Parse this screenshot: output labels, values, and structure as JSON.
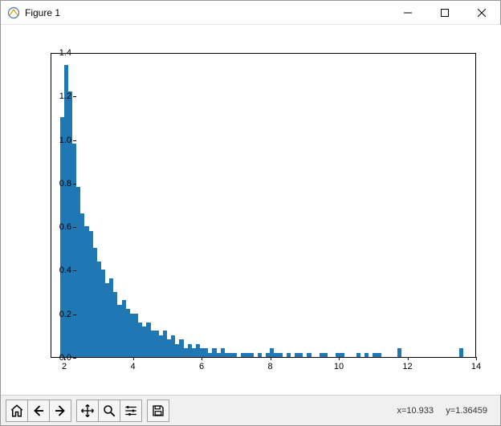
{
  "window": {
    "title": "Figure 1"
  },
  "toolbar": {
    "buttons": [
      {
        "name": "home-button",
        "icon": "home-icon"
      },
      {
        "name": "back-button",
        "icon": "arrow-left-icon"
      },
      {
        "name": "forward-button",
        "icon": "arrow-right-icon"
      },
      {
        "name": "pan-button",
        "icon": "move-icon"
      },
      {
        "name": "zoom-button",
        "icon": "magnify-icon"
      },
      {
        "name": "subplots-button",
        "icon": "sliders-icon"
      },
      {
        "name": "save-button",
        "icon": "save-icon"
      }
    ],
    "coord_readout": "x=10.933     y=1.36459"
  },
  "chart_data": {
    "type": "bar",
    "title": "",
    "xlabel": "",
    "ylabel": "",
    "xlim": [
      1.6,
      14.0
    ],
    "ylim": [
      0.0,
      1.4
    ],
    "xticks": [
      2,
      4,
      6,
      8,
      10,
      12,
      14
    ],
    "yticks": [
      0.0,
      0.2,
      0.4,
      0.6,
      0.8,
      1.0,
      1.2,
      1.4
    ],
    "bar_color": "#1f77b4",
    "bin_width": 0.12,
    "bins_start": 1.85,
    "values": [
      1.1,
      1.34,
      1.22,
      0.98,
      0.78,
      0.66,
      0.6,
      0.58,
      0.5,
      0.44,
      0.4,
      0.34,
      0.36,
      0.3,
      0.24,
      0.26,
      0.22,
      0.2,
      0.2,
      0.16,
      0.14,
      0.16,
      0.12,
      0.12,
      0.1,
      0.12,
      0.08,
      0.1,
      0.06,
      0.08,
      0.04,
      0.06,
      0.04,
      0.06,
      0.04,
      0.04,
      0.02,
      0.04,
      0.02,
      0.04,
      0.02,
      0.02,
      0.02,
      0.0,
      0.02,
      0.02,
      0.02,
      0.0,
      0.02,
      0.0,
      0.02,
      0.04,
      0.02,
      0.02,
      0.0,
      0.02,
      0.0,
      0.02,
      0.02,
      0.0,
      0.02,
      0.0,
      0.0,
      0.02,
      0.02,
      0.0,
      0.0,
      0.02,
      0.02,
      0.0,
      0.0,
      0.0,
      0.02,
      0.0,
      0.02,
      0.0,
      0.02,
      0.02,
      0.0,
      0.0,
      0.0,
      0.0,
      0.04,
      0.0,
      0.0,
      0.0,
      0.0,
      0.0,
      0.0,
      0.0,
      0.0,
      0.0,
      0.0,
      0.0,
      0.0,
      0.0,
      0.0,
      0.04,
      0.0,
      0.0
    ]
  }
}
